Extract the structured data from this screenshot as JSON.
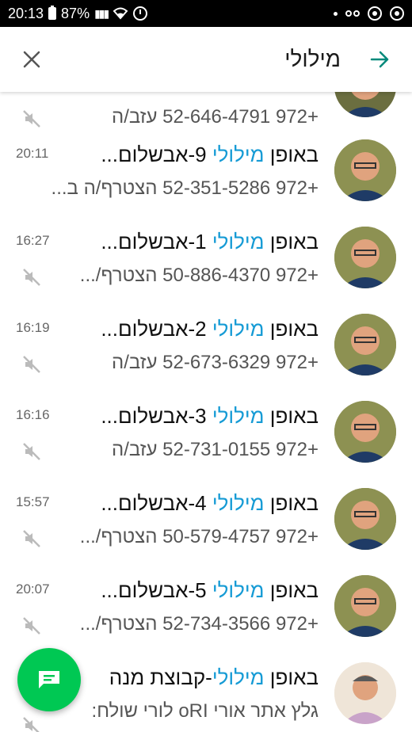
{
  "status_bar": {
    "time": "20:13",
    "battery_percent": "87%",
    "icons": [
      "battery-icon",
      "signal-icon",
      "wifi-icon",
      "alarm-icon",
      "dot-icon",
      "voicemail-icon",
      "ring-icon"
    ]
  },
  "header": {
    "query": "מילולי",
    "close_icon": "close-icon",
    "back_icon": "arrow-icon",
    "accent_color": "#00897b"
  },
  "results": [
    {
      "partial": true,
      "title_pre": "",
      "title_hl": "",
      "title_post": "",
      "time": "",
      "subtitle": "+972 52-646-4791 עזב/ה",
      "muted": true
    },
    {
      "title_pre": "באופן ",
      "title_hl": "מילולי",
      "title_post": " 9-אבשלום...",
      "time": "20:11",
      "subtitle": "+972 52-351-5286 הצטרף/ה ב...",
      "muted": false
    },
    {
      "title_pre": "באופן ",
      "title_hl": "מילולי",
      "title_post": " 1-אבשלום...",
      "time": "16:27",
      "subtitle": "+972 50-886-4370 הצטרף/...",
      "muted": true
    },
    {
      "title_pre": "באופן ",
      "title_hl": "מילולי",
      "title_post": " 2-אבשלום...",
      "time": "16:19",
      "subtitle": "+972 52-673-6329 עזב/ה",
      "muted": true
    },
    {
      "title_pre": "באופן ",
      "title_hl": "מילולי",
      "title_post": " 3-אבשלום...",
      "time": "16:16",
      "subtitle": "+972 52-731-0155 עזב/ה",
      "muted": true
    },
    {
      "title_pre": "באופן ",
      "title_hl": "מילולי",
      "title_post": " 4-אבשלום...",
      "time": "15:57",
      "subtitle": "+972 50-579-4757 הצטרף/...",
      "muted": true
    },
    {
      "title_pre": "באופן ",
      "title_hl": "מילולי",
      "title_post": " 5-אבשלום...",
      "time": "20:07",
      "subtitle": "+972 52-734-3566 הצטרף/...",
      "muted": true
    },
    {
      "title_pre": "באופן ",
      "title_hl": "מילולי",
      "title_post": "-קבוצת מנה",
      "time": "",
      "subtitle": "גלץ אתר אורי oRI לורי שולח:",
      "muted": true
    }
  ],
  "fab": {
    "icon": "new-chat-icon",
    "color": "#00c853"
  },
  "highlight_color": "#169bd5"
}
